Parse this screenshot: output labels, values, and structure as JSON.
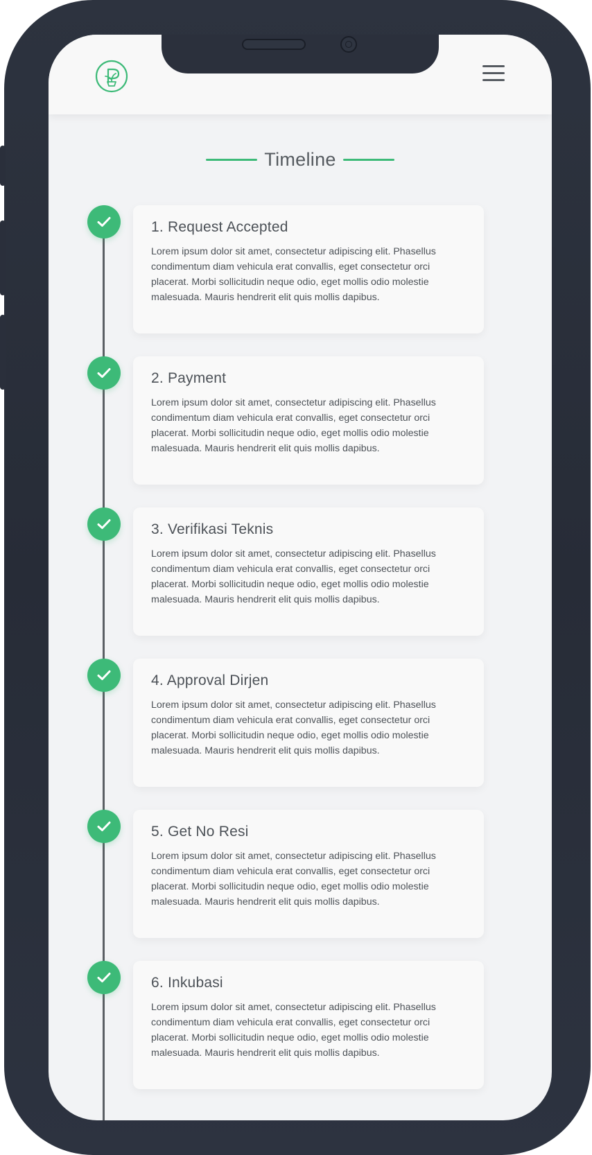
{
  "header": {
    "logo_icon": "plant-pot-logo",
    "menu_icon": "hamburger-icon"
  },
  "section": {
    "title": "Timeline"
  },
  "colors": {
    "accent": "#3dba78",
    "text": "#4c5157",
    "frame": "#2b303c"
  },
  "timeline": [
    {
      "title": "1. Request Accepted",
      "body": "Lorem ipsum dolor sit amet, consectetur adipiscing elit. Phasellus condimentum diam vehicula erat convallis, eget consectetur orci placerat. Morbi sollicitudin neque odio, eget mollis odio molestie malesuada. Mauris hendrerit elit quis mollis dapibus.",
      "status_icon": "check-icon"
    },
    {
      "title": "2. Payment",
      "body": "Lorem ipsum dolor sit amet, consectetur adipiscing elit. Phasellus condimentum diam vehicula erat convallis, eget consectetur orci placerat. Morbi sollicitudin neque odio, eget mollis odio molestie malesuada. Mauris hendrerit elit quis mollis dapibus.",
      "status_icon": "check-icon"
    },
    {
      "title": "3. Verifikasi Teknis",
      "body": "Lorem ipsum dolor sit amet, consectetur adipiscing elit. Phasellus condimentum diam vehicula erat convallis, eget consectetur orci placerat. Morbi sollicitudin neque odio, eget mollis odio molestie malesuada. Mauris hendrerit elit quis mollis dapibus.",
      "status_icon": "check-icon"
    },
    {
      "title": "4. Approval Dirjen",
      "body": "Lorem ipsum dolor sit amet, consectetur adipiscing elit. Phasellus condimentum diam vehicula erat convallis, eget consectetur orci placerat. Morbi sollicitudin neque odio, eget mollis odio molestie malesuada. Mauris hendrerit elit quis mollis dapibus.",
      "status_icon": "check-icon"
    },
    {
      "title": "5. Get No Resi",
      "body": "Lorem ipsum dolor sit amet, consectetur adipiscing elit. Phasellus condimentum diam vehicula erat convallis, eget consectetur orci placerat. Morbi sollicitudin neque odio, eget mollis odio molestie malesuada. Mauris hendrerit elit quis mollis dapibus.",
      "status_icon": "check-icon"
    },
    {
      "title": "6. Inkubasi",
      "body": "Lorem ipsum dolor sit amet, consectetur adipiscing elit. Phasellus condimentum diam vehicula erat convallis, eget consectetur orci placerat. Morbi sollicitudin neque odio, eget mollis odio molestie malesuada. Mauris hendrerit elit quis mollis dapibus.",
      "status_icon": "check-icon"
    }
  ]
}
